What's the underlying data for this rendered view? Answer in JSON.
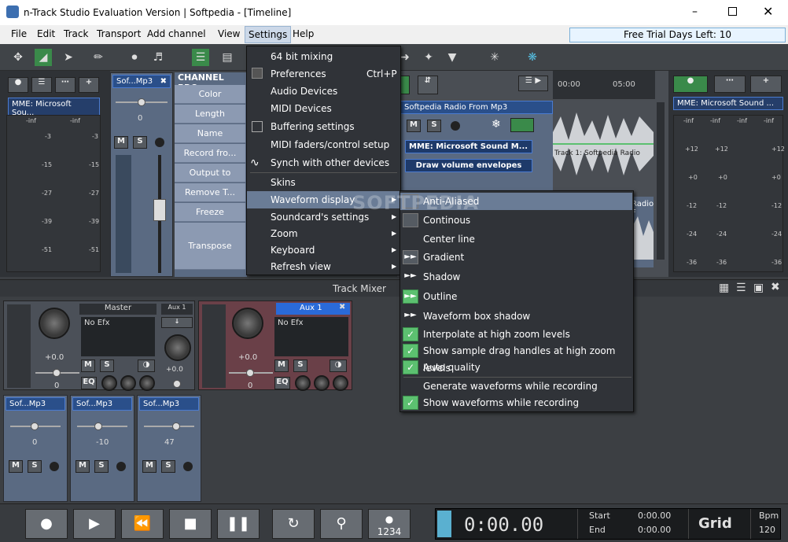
{
  "window": {
    "title": "n-Track Studio Evaluation Version | Softpedia - [Timeline]"
  },
  "menubar": {
    "items": [
      "File",
      "Edit",
      "Track",
      "Transport",
      "Add channel",
      "View",
      "Settings",
      "Help"
    ],
    "trial": "Free Trial Days Left: 10"
  },
  "left_strip": {
    "device": "MME: Microsoft Sou...",
    "inf": "-inf",
    "scale": [
      "-3",
      "-15",
      "-27",
      "-39",
      "-51"
    ]
  },
  "track_strip": {
    "name": "Sof...Mp3",
    "value": "0",
    "m": "M",
    "s": "S"
  },
  "channel_props": {
    "header": "CHANNEL PRO",
    "items": [
      "Color",
      "Length",
      "Name",
      "Record fro...",
      "Output to",
      "Remove T...",
      "Freeze",
      "Transpose"
    ]
  },
  "timeline": {
    "time1": "00:00",
    "time2": "05:00",
    "clip_title": "Softpedia Radio From Mp3",
    "device": "MME: Microsoft Sound M...",
    "envelopes": "Draw volume envelopes",
    "wave_label": "Track 1: Softpedia Radio",
    "wave_label2": "Radio F"
  },
  "right_strip": {
    "device": "MME: Microsoft Sound ...",
    "inf": "-inf",
    "scale": [
      "+12",
      "+0",
      "-12",
      "-24",
      "-36"
    ]
  },
  "mixer": {
    "title": "Track Mixer",
    "master": {
      "name": "Master",
      "efx": "No Efx",
      "gain": "+0.0",
      "pan": "0",
      "m": "M",
      "s": "S",
      "eq": "EQ"
    },
    "aux_small": {
      "name": "Aux 1",
      "gain": "+0.0",
      "pan": "0"
    },
    "aux1": {
      "name": "Aux 1",
      "efx": "No Efx",
      "gain": "+0.0",
      "pan": "0"
    },
    "tracks": [
      {
        "name": "Sof...Mp3",
        "value": "0"
      },
      {
        "name": "Sof...Mp3",
        "value": "-10"
      },
      {
        "name": "Sof...Mp3",
        "value": "47"
      }
    ]
  },
  "settings_menu": {
    "items": [
      {
        "label": "64 bit mixing",
        "shortcut": ""
      },
      {
        "label": "Preferences",
        "shortcut": "Ctrl+P"
      },
      {
        "label": "Audio Devices",
        "shortcut": ""
      },
      {
        "label": "MIDI Devices",
        "shortcut": ""
      },
      {
        "label": "Buffering settings",
        "shortcut": ""
      },
      {
        "label": "MIDI faders/control setup",
        "shortcut": ""
      },
      {
        "label": "Synch with other devices",
        "shortcut": ""
      },
      {
        "label": "Skins",
        "shortcut": ""
      },
      {
        "label": "Waveform display",
        "shortcut": ""
      },
      {
        "label": "Soundcard's settings",
        "shortcut": ""
      },
      {
        "label": "Zoom",
        "shortcut": ""
      },
      {
        "label": "Keyboard",
        "shortcut": ""
      },
      {
        "label": "Refresh view",
        "shortcut": ""
      }
    ]
  },
  "waveform_submenu": {
    "items": [
      "Anti-Aliased",
      "Continous",
      "Center line",
      "Gradient",
      "Shadow",
      "Outline",
      "Waveform box shadow",
      "Interpolate at high zoom levels",
      "Show sample drag handles at high zoom levels",
      "Auto quality",
      "Generate waveforms while recording",
      "Show waveforms while recording"
    ]
  },
  "watermark": "SOFTPEDIA",
  "transport": {
    "time": "0:00.00",
    "start_label": "Start",
    "start_val": "0:00.00",
    "end_label": "End",
    "end_val": "0:00.00",
    "grid": "Grid",
    "bpm_label": "Bpm",
    "bpm_val": "120",
    "count": "1234"
  }
}
